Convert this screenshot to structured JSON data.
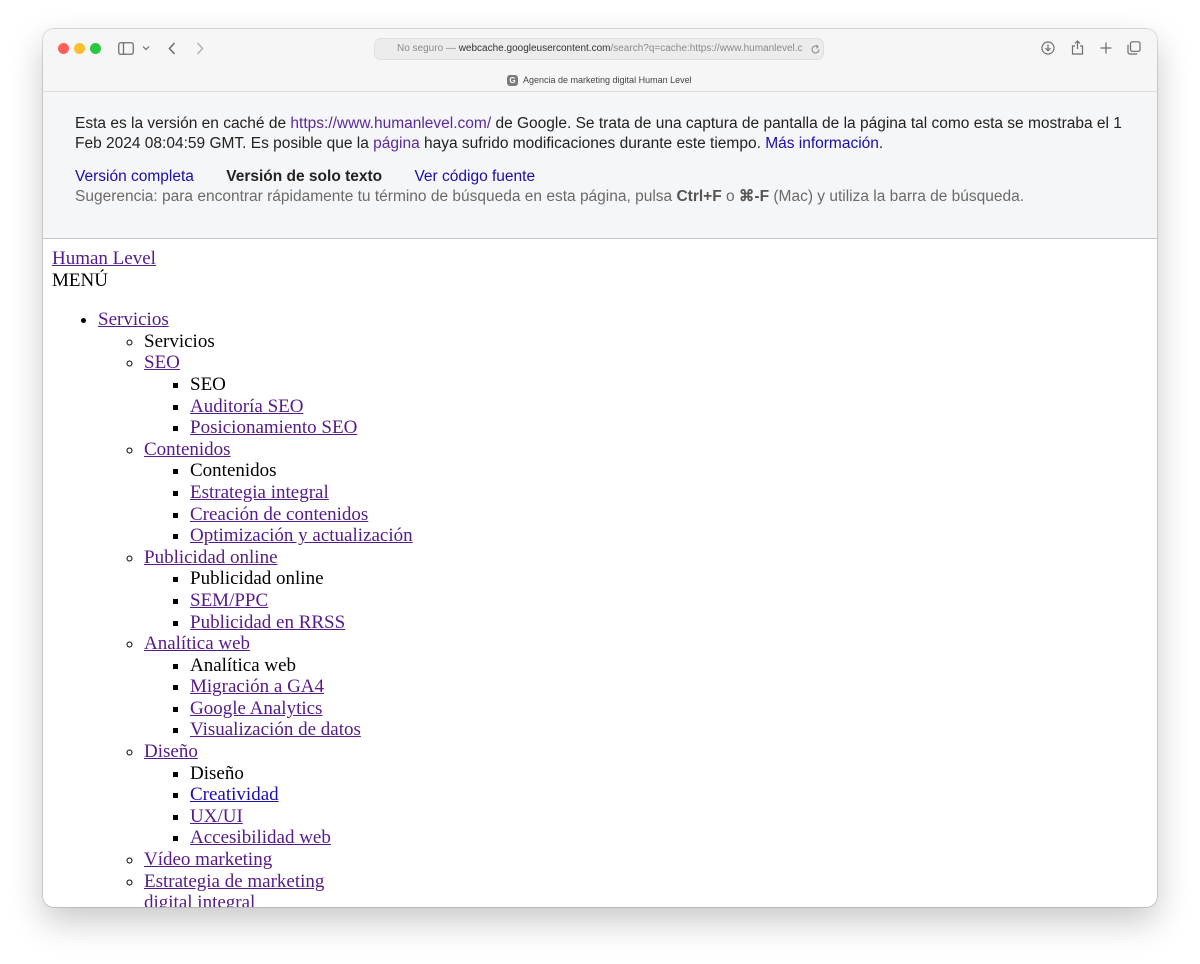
{
  "browser": {
    "address_prefix": "No seguro — ",
    "address_host": "webcache.googleusercontent.com",
    "address_path": "/search?q=cache:https://www.humanlevel.com/",
    "tab_title": "Agencia de marketing digital Human Level",
    "tab_favicon_letter": "G"
  },
  "banner": {
    "line_start": "Esta es la versión en caché de ",
    "cached_url": "https://www.humanlevel.com/",
    "line_mid": " de Google. Se trata de una captura de pantalla de la página tal como esta se mostraba el 1 Feb 2024 08:04:59 GMT. Es posible que la ",
    "page_link": "página",
    "line_after_page": " haya sufrido modificaciones durante este tiempo. ",
    "more_info": "Más información",
    "line_end": ".",
    "full_version": "Versión completa",
    "text_only": "Versión de solo texto",
    "view_source": "Ver código fuente",
    "hint_start": "Sugerencia: para encontrar rápidamente tu término de búsqueda en esta página, pulsa ",
    "hint_ctrl": "Ctrl+F",
    "hint_or": " o ",
    "hint_cmd": "⌘-F",
    "hint_end": " (Mac) y utiliza la barra de búsqueda."
  },
  "page": {
    "site_name": "Human Level",
    "menu_label": "MENÚ",
    "nav": {
      "servicios": "Servicios",
      "servicios_plain": "Servicios",
      "seo": "SEO",
      "seo_plain": "SEO",
      "seo_items": [
        "Auditoría SEO",
        "Posicionamiento SEO"
      ],
      "contenidos": "Contenidos",
      "contenidos_plain": "Contenidos",
      "contenidos_items": [
        "Estrategia integral",
        "Creación de contenidos",
        "Optimización y actualización"
      ],
      "publicidad": "Publicidad online",
      "publicidad_plain": "Publicidad online",
      "publicidad_items": [
        "SEM/PPC",
        "Publicidad en RRSS"
      ],
      "analitica": "Analítica web",
      "analitica_plain": "Analítica web",
      "analitica_items": [
        "Migración a GA4",
        "Google Analytics",
        "Visualización de datos"
      ],
      "diseno": "Diseño",
      "diseno_plain": "Diseño",
      "diseno_items": [
        "Creatividad",
        "UX/UI",
        "Accesibilidad web"
      ],
      "video": "Vídeo marketing",
      "estrategia": "Estrategia de marketing digital integral"
    }
  },
  "colors": {
    "visited_link": "#551a8b",
    "unvisited_link": "#1a0dab"
  }
}
